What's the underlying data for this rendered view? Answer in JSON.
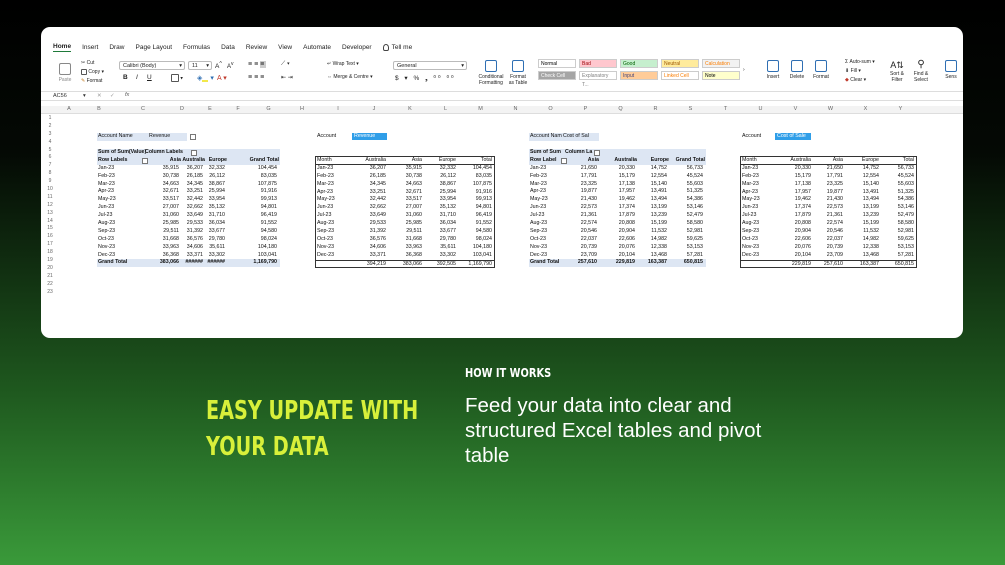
{
  "ribbon": {
    "tabs": [
      "Home",
      "Insert",
      "Draw",
      "Page Layout",
      "Formulas",
      "Data",
      "Review",
      "View",
      "Automate",
      "Developer"
    ],
    "tell_me": "Tell me",
    "paste": "Paste",
    "cut": "Cut",
    "copy": "Copy",
    "format": "Format",
    "font_name": "Calibri (Body)",
    "font_size": "11",
    "bold": "B",
    "italic": "I",
    "underline": "U",
    "wrap_text": "Wrap Text",
    "merge_centre": "Merge & Centre",
    "number_format": "General",
    "cond_format": [
      "Conditional",
      "Formatting"
    ],
    "format_table": [
      "Format",
      "as Table"
    ],
    "styles": [
      {
        "label": "Normal",
        "bg": "#ffffff",
        "fg": "#000000"
      },
      {
        "label": "Bad",
        "bg": "#ffc7ce",
        "fg": "#9c0006"
      },
      {
        "label": "Good",
        "bg": "#c6efce",
        "fg": "#006100"
      },
      {
        "label": "Neutral",
        "bg": "#ffeb9c",
        "fg": "#9c5700"
      },
      {
        "label": "Calculation",
        "bg": "#f2f2f2",
        "fg": "#fa7d00"
      },
      {
        "label": "Check Cell",
        "bg": "#a5a5a5",
        "fg": "#ffffff"
      },
      {
        "label": "Explanatory T...",
        "bg": "#ffffff",
        "fg": "#7f7f7f"
      },
      {
        "label": "Input",
        "bg": "#ffcc99",
        "fg": "#3f3f76"
      },
      {
        "label": "Linked Cell",
        "bg": "#ffffff",
        "fg": "#fa7d00"
      },
      {
        "label": "Note",
        "bg": "#ffffcc",
        "fg": "#000000"
      }
    ],
    "insert": "Insert",
    "delete": "Delete",
    "format_cells": "Format",
    "autosum": "Auto-sum",
    "fill": "Fill",
    "clear": "Clear",
    "sort_filter": [
      "Sort &",
      "Filter"
    ],
    "find_select": [
      "Find &",
      "Select"
    ],
    "sensitivity": "Sens"
  },
  "formula_bar": {
    "name_box": "AC56",
    "fx": "fx",
    "value": ""
  },
  "columns": [
    "A",
    "B",
    "C",
    "D",
    "E",
    "F",
    "G",
    "H",
    "I",
    "J",
    "K",
    "L",
    "M",
    "N",
    "O",
    "P",
    "Q",
    "R",
    "S",
    "T",
    "U",
    "V",
    "W",
    "X",
    "Y"
  ],
  "rows": [
    "1",
    "2",
    "3",
    "4",
    "5",
    "6",
    "7",
    "8",
    "9",
    "10",
    "11",
    "12",
    "13",
    "14",
    "15",
    "16",
    "17",
    "18",
    "19",
    "20",
    "21",
    "22",
    "23"
  ],
  "months": [
    "Jan-23",
    "Feb-23",
    "Mar-23",
    "Apr-23",
    "May-23",
    "Jun-23",
    "Jul-23",
    "Aug-23",
    "Sep-23",
    "Oct-23",
    "Nov-23",
    "Dec-23"
  ],
  "pivot1": {
    "filter_label": "Account Name",
    "filter_value": "Revenue",
    "sum_label": "Sum of Sum(Value)",
    "col_labels": "Column Labels",
    "row_labels": "Row Labels",
    "headers": [
      "Asia",
      "Australia",
      "Europe",
      "Grand Total"
    ],
    "rows": [
      [
        "35,915",
        "36,207",
        "32,332",
        "104,454"
      ],
      [
        "30,738",
        "26,185",
        "26,112",
        "83,035"
      ],
      [
        "34,663",
        "34,345",
        "38,867",
        "107,875"
      ],
      [
        "32,671",
        "33,251",
        "25,994",
        "91,916"
      ],
      [
        "33,517",
        "32,442",
        "33,954",
        "99,913"
      ],
      [
        "27,007",
        "32,662",
        "35,132",
        "94,801"
      ],
      [
        "31,060",
        "33,649",
        "31,710",
        "96,419"
      ],
      [
        "25,985",
        "29,533",
        "36,034",
        "91,552"
      ],
      [
        "29,511",
        "31,392",
        "33,677",
        "94,580"
      ],
      [
        "31,668",
        "36,576",
        "29,780",
        "98,024"
      ],
      [
        "33,963",
        "34,606",
        "35,611",
        "104,180"
      ],
      [
        "36,368",
        "33,371",
        "33,302",
        "103,041"
      ]
    ],
    "total_label": "Grand Total",
    "totals": [
      "383,066",
      "######",
      "######",
      "1,169,790"
    ]
  },
  "table1": {
    "account_label": "Account",
    "account_value": "Revenue",
    "headers": [
      "Month",
      "Australia",
      "Asia",
      "Europe",
      "Total"
    ],
    "rows": [
      [
        "36,207",
        "35,915",
        "32,332",
        "104,454"
      ],
      [
        "26,185",
        "30,738",
        "26,112",
        "83,035"
      ],
      [
        "34,345",
        "34,663",
        "38,867",
        "107,875"
      ],
      [
        "33,251",
        "32,671",
        "25,994",
        "91,916"
      ],
      [
        "32,442",
        "33,517",
        "33,954",
        "99,913"
      ],
      [
        "32,662",
        "27,007",
        "35,132",
        "94,801"
      ],
      [
        "33,649",
        "31,060",
        "31,710",
        "96,419"
      ],
      [
        "29,533",
        "25,985",
        "36,034",
        "91,552"
      ],
      [
        "31,392",
        "29,511",
        "33,677",
        "94,580"
      ],
      [
        "36,576",
        "31,668",
        "29,780",
        "98,024"
      ],
      [
        "34,606",
        "33,963",
        "35,611",
        "104,180"
      ],
      [
        "33,371",
        "36,368",
        "33,302",
        "103,041"
      ]
    ],
    "totals": [
      "394,219",
      "383,066",
      "392,505",
      "1,169,790"
    ]
  },
  "pivot2": {
    "filter_label": "Account Nam",
    "filter_value": "Cost of Sal",
    "sum_label": "Sum of Sum",
    "col_labels": "Column La",
    "row_labels": "Row Label",
    "headers": [
      "Asia",
      "Australia",
      "Europe",
      "Grand Total"
    ],
    "rows": [
      [
        "21,650",
        "20,330",
        "14,752",
        "56,733"
      ],
      [
        "17,791",
        "15,179",
        "12,554",
        "45,524"
      ],
      [
        "23,325",
        "17,138",
        "15,140",
        "55,603"
      ],
      [
        "19,877",
        "17,957",
        "13,491",
        "51,325"
      ],
      [
        "21,430",
        "19,462",
        "13,494",
        "54,386"
      ],
      [
        "22,573",
        "17,374",
        "13,199",
        "53,146"
      ],
      [
        "21,361",
        "17,879",
        "13,239",
        "52,479"
      ],
      [
        "22,574",
        "20,808",
        "15,199",
        "58,580"
      ],
      [
        "20,546",
        "20,904",
        "11,532",
        "52,981"
      ],
      [
        "22,037",
        "22,606",
        "14,982",
        "59,625"
      ],
      [
        "20,739",
        "20,076",
        "12,338",
        "53,153"
      ],
      [
        "23,709",
        "20,104",
        "13,468",
        "57,281"
      ]
    ],
    "total_label": "Grand Total",
    "totals": [
      "257,610",
      "229,819",
      "163,387",
      "650,815"
    ]
  },
  "table2": {
    "account_label": "Account",
    "account_value": "Cost of Sale",
    "headers": [
      "Month",
      "Australia",
      "Asia",
      "Europe",
      "Total"
    ],
    "rows": [
      [
        "20,330",
        "21,650",
        "14,752",
        "56,733"
      ],
      [
        "15,179",
        "17,791",
        "12,554",
        "45,524"
      ],
      [
        "17,138",
        "23,325",
        "15,140",
        "55,603"
      ],
      [
        "17,957",
        "19,877",
        "13,491",
        "51,325"
      ],
      [
        "19,462",
        "21,430",
        "13,494",
        "54,386"
      ],
      [
        "17,374",
        "22,573",
        "13,199",
        "53,146"
      ],
      [
        "17,879",
        "21,361",
        "13,239",
        "52,479"
      ],
      [
        "20,808",
        "22,574",
        "15,199",
        "58,580"
      ],
      [
        "20,904",
        "20,546",
        "11,532",
        "52,981"
      ],
      [
        "22,606",
        "22,037",
        "14,982",
        "59,625"
      ],
      [
        "20,076",
        "20,739",
        "12,338",
        "53,153"
      ],
      [
        "20,104",
        "23,709",
        "13,468",
        "57,281"
      ]
    ],
    "totals": [
      "229,819",
      "257,610",
      "163,387",
      "650,815"
    ]
  },
  "marketing": {
    "headline": [
      "EASY UPDATE WITH",
      "YOUR DATA"
    ],
    "section_label": "HOW IT WORKS",
    "description": "Feed your data into clear and structured Excel tables and pivot table"
  }
}
